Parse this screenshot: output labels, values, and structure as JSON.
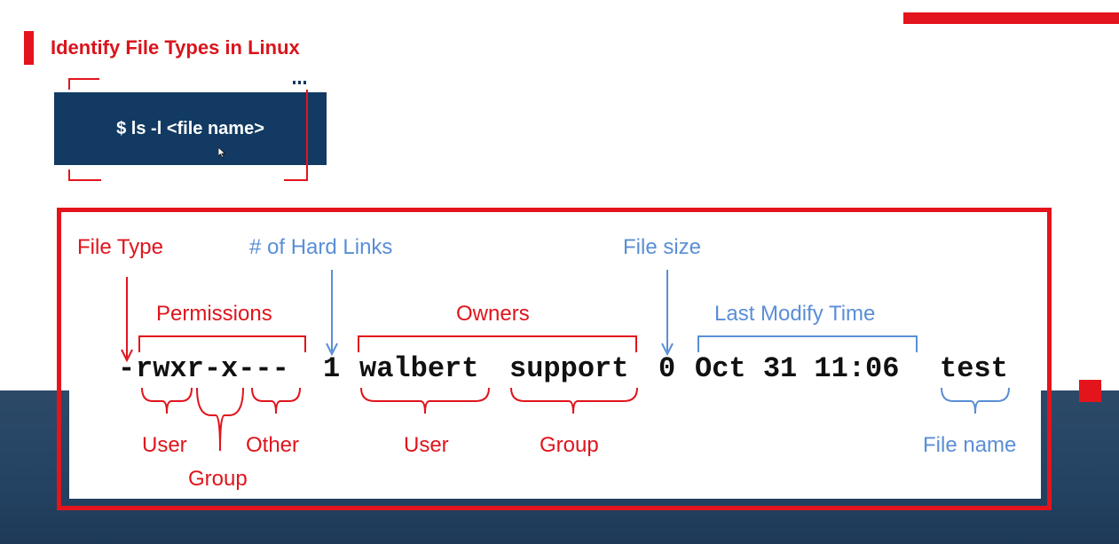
{
  "slide": {
    "title": "Identify File Types in Linux",
    "command": "$ ls -l <file name>",
    "colors": {
      "accent": "#e4141c",
      "navy": "#123a63",
      "blue_label": "#5a8ed6"
    }
  },
  "diagram": {
    "labels": {
      "file_type": "File Type",
      "hard_links": "# of Hard Links",
      "file_size": "File size",
      "permissions": "Permissions",
      "owners": "Owners",
      "last_modify_time": "Last Modify Time",
      "perm_user": "User",
      "perm_group": "Group",
      "perm_other": "Other",
      "owner_user": "User",
      "owner_group": "Group",
      "file_name": "File name"
    },
    "listing": {
      "type_char": "-",
      "permissions": "rwxr-x---",
      "links": "1",
      "owner": "walbert",
      "group": "support",
      "size": "0",
      "date": "Oct 31 11:06",
      "name": "test"
    }
  }
}
